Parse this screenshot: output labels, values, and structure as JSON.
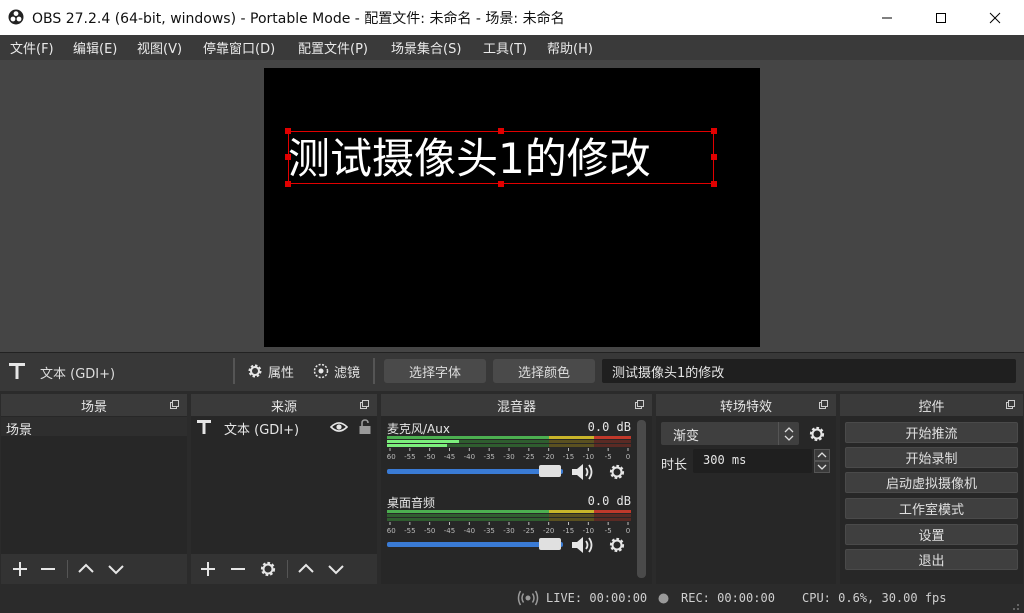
{
  "window": {
    "title": "OBS 27.2.4 (64-bit, windows) - Portable Mode - 配置文件: 未命名 - 场景: 未命名"
  },
  "menu": [
    "文件(F)",
    "编辑(E)",
    "视图(V)",
    "停靠窗口(D)",
    "配置文件(P)",
    "场景集合(S)",
    "工具(T)",
    "帮助(H)"
  ],
  "preview": {
    "text": "测试摄像头1的修改"
  },
  "propbar": {
    "source_name": "文本 (GDI+)",
    "properties_label": "属性",
    "filters_label": "滤镜",
    "select_font_label": "选择字体",
    "select_color_label": "选择颜色",
    "text_value": "测试摄像头1的修改"
  },
  "scenes": {
    "title": "场景",
    "items": [
      "场景"
    ]
  },
  "sources": {
    "title": "来源",
    "items": [
      "文本 (GDI+)"
    ]
  },
  "mixer": {
    "title": "混音器",
    "tracks": [
      {
        "name": "麦克风/Aux",
        "db": "0.0 dB",
        "level": 0.9
      },
      {
        "name": "桌面音频",
        "db": "0.0 dB",
        "level": 0.9
      }
    ],
    "ticks": [
      "-60",
      "-55",
      "-50",
      "-45",
      "-40",
      "-35",
      "-30",
      "-25",
      "-20",
      "-15",
      "-10",
      "-5",
      "0"
    ]
  },
  "transitions": {
    "title": "转场特效",
    "selected": "渐变",
    "duration_label": "时长",
    "duration_value": "300 ms"
  },
  "controls": {
    "title": "控件",
    "buttons": [
      "开始推流",
      "开始录制",
      "启动虚拟摄像机",
      "工作室模式",
      "设置",
      "退出"
    ]
  },
  "status": {
    "live": "LIVE: 00:00:00",
    "rec": "REC: 00:00:00",
    "cpu": "CPU: 0.6%, 30.00 fps"
  },
  "colors": {
    "selection": "#e10000",
    "meter_green": "#4caf50",
    "meter_yellow": "#c9b52a",
    "meter_red": "#c0392b",
    "slider": "#3a7bd5"
  }
}
